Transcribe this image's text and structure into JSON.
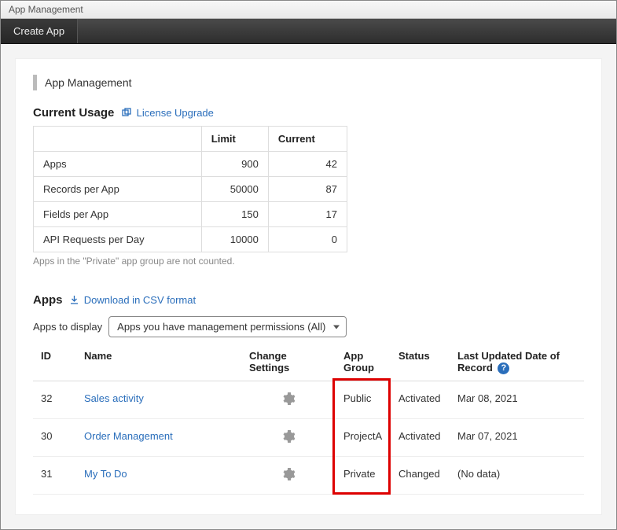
{
  "window": {
    "title": "App Management"
  },
  "toolbar": {
    "create_app_label": "Create App"
  },
  "page": {
    "title": "App Management"
  },
  "usage": {
    "section_title": "Current Usage",
    "license_link": "License Upgrade",
    "headers": {
      "limit": "Limit",
      "current": "Current"
    },
    "rows": [
      {
        "label": "Apps",
        "limit": "900",
        "current": "42"
      },
      {
        "label": "Records per App",
        "limit": "50000",
        "current": "87"
      },
      {
        "label": "Fields per App",
        "limit": "150",
        "current": "17"
      },
      {
        "label": "API Requests per Day",
        "limit": "10000",
        "current": "0"
      }
    ],
    "note": "Apps in the \"Private\" app group are not counted."
  },
  "apps": {
    "section_title": "Apps",
    "download_link": "Download in CSV format",
    "filter_label": "Apps to display",
    "filter_selected": "Apps you have management permissions (All)",
    "columns": {
      "id": "ID",
      "name": "Name",
      "change_settings": "Change Settings",
      "app_group": "App Group",
      "status": "Status",
      "last_updated": "Last Updated Date of Record"
    },
    "rows": [
      {
        "id": "32",
        "name": "Sales activity",
        "app_group": "Public",
        "status": "Activated",
        "last_updated": "Mar 08, 2021"
      },
      {
        "id": "30",
        "name": "Order Management",
        "app_group": "ProjectA",
        "status": "Activated",
        "last_updated": "Mar 07, 2021"
      },
      {
        "id": "31",
        "name": "My To Do",
        "app_group": "Private",
        "status": "Changed",
        "last_updated": "(No data)"
      }
    ]
  }
}
